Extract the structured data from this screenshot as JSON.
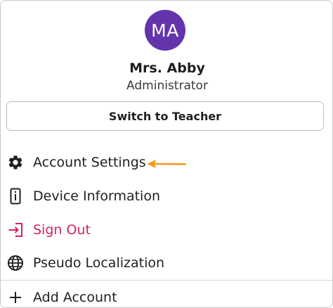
{
  "profile": {
    "initials": "MA",
    "name": "Mrs. Abby",
    "role": "Administrator",
    "avatar_color": "#6434ad"
  },
  "switch_button": {
    "label": "Switch to Teacher"
  },
  "menu": {
    "items": [
      {
        "label": "Account Settings",
        "icon": "gear-icon"
      },
      {
        "label": "Device Information",
        "icon": "device-info-icon"
      },
      {
        "label": "Sign Out",
        "icon": "sign-out-icon",
        "color": "#d6245c"
      },
      {
        "label": "Pseudo Localization",
        "icon": "globe-icon"
      },
      {
        "label": "Add Account",
        "icon": "plus-icon"
      }
    ]
  },
  "annotation": {
    "arrow_color": "#f39a1e",
    "points_to": "Account Settings"
  }
}
